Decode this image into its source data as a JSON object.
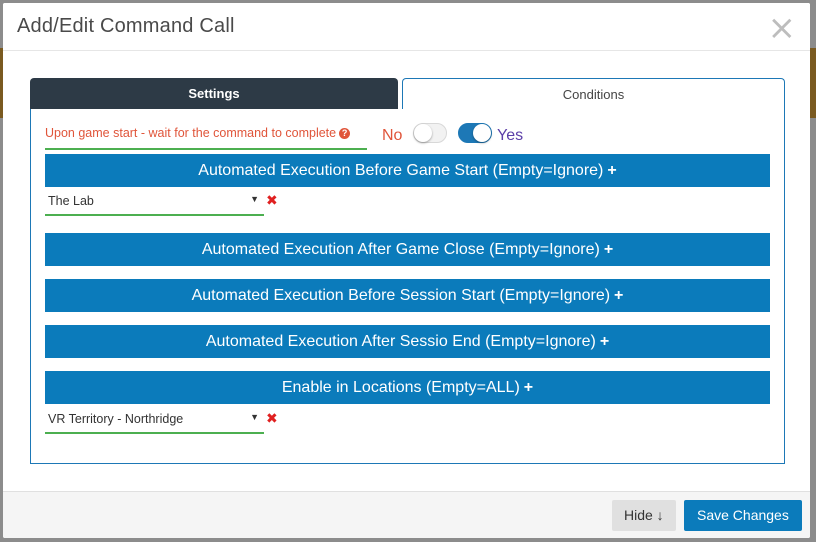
{
  "modal": {
    "title": "Add/Edit Command Call",
    "close_icon": "×"
  },
  "tabs": [
    {
      "label": "Settings",
      "active": false
    },
    {
      "label": "Conditions",
      "active": true
    }
  ],
  "wait": {
    "label": "Upon game start - wait for the command to complete",
    "help_icon": "?",
    "no_label": "No",
    "yes_label": "Yes",
    "value": "Yes"
  },
  "sections": {
    "before_game_start": "Automated Execution Before Game Start (Empty=Ignore)",
    "after_game_close": "Automated Execution After Game Close (Empty=Ignore)",
    "before_session_start": "Automated Execution Before Session Start (Empty=Ignore)",
    "after_session_end": "Automated Execution After Sessio End (Empty=Ignore)",
    "enable_locations": "Enable in Locations (Empty=ALL)",
    "plus_icon": "+"
  },
  "selects": {
    "game_start_value": "The Lab",
    "location_value": "VR Territory - Northridge",
    "arrow": "▼",
    "remove_icon": "✖"
  },
  "footer": {
    "hide_label": "Hide ↓",
    "save_label": "Save Changes"
  },
  "colors": {
    "accent": "#0b7bbb",
    "tab_dark": "#2d3a46",
    "warning_text": "#e0553a",
    "yes_text": "#5b3ea8",
    "valid_underline": "#4caf50",
    "remove": "#e02020"
  }
}
